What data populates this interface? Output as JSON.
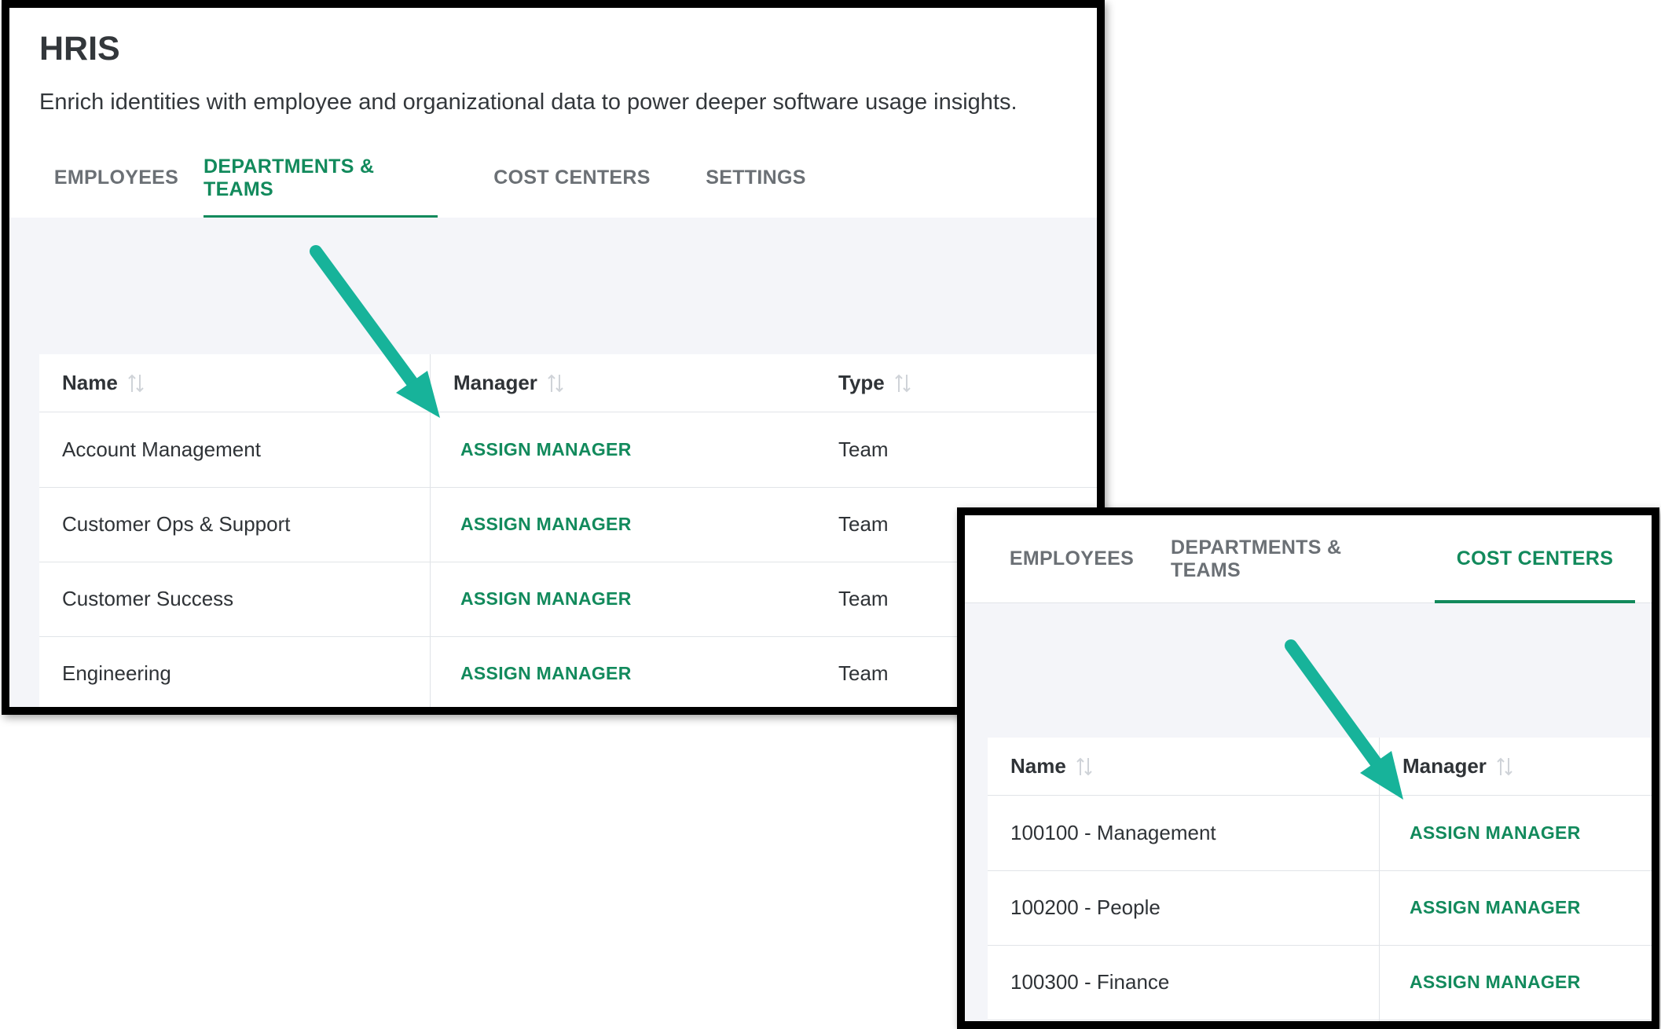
{
  "page": {
    "title": "HRIS",
    "subtitle": "Enrich identities with employee and organizational data to power deeper software usage insights."
  },
  "tabs": [
    "EMPLOYEES",
    "DEPARTMENTS & TEAMS",
    "COST CENTERS",
    "SETTINGS"
  ],
  "departments_table": {
    "active_tab": "DEPARTMENTS & TEAMS",
    "columns": [
      "Name",
      "Manager",
      "Type"
    ],
    "rows": [
      {
        "name": "Account Management",
        "manager": "ASSIGN MANAGER",
        "type": "Team"
      },
      {
        "name": "Customer Ops & Support",
        "manager": "ASSIGN MANAGER",
        "type": "Team"
      },
      {
        "name": "Customer Success",
        "manager": "ASSIGN MANAGER",
        "type": "Team"
      },
      {
        "name": "Engineering",
        "manager": "ASSIGN MANAGER",
        "type": "Team"
      }
    ]
  },
  "cost_centers_panel": {
    "tabs": [
      "EMPLOYEES",
      "DEPARTMENTS & TEAMS",
      "COST CENTERS"
    ],
    "active_tab": "COST CENTERS",
    "columns": [
      "Name",
      "Manager"
    ],
    "rows": [
      {
        "name": "100100 - Management",
        "manager": "ASSIGN MANAGER"
      },
      {
        "name": "100200 - People",
        "manager": "ASSIGN MANAGER"
      },
      {
        "name": "100300 - Finance",
        "manager": "ASSIGN MANAGER"
      }
    ]
  },
  "icons": {
    "sort": "sort-arrows-icon",
    "annotation": "teal-arrow-icon"
  },
  "colors": {
    "accent": "#128a5c",
    "annotation_arrow": "#17b39a",
    "text": "#2f3337",
    "muted_tab": "#6b7075",
    "gray_area": "#f4f5f9"
  }
}
